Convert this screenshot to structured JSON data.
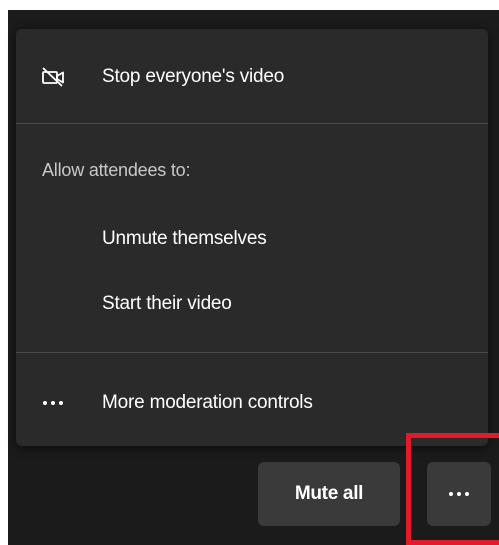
{
  "menu": {
    "stop_video": {
      "label": "Stop everyone's video",
      "icon": "video-off-icon"
    },
    "section_title": "Allow attendees to:",
    "options": [
      {
        "label": "Unmute themselves"
      },
      {
        "label": "Start their video"
      }
    ],
    "more_controls": {
      "label": "More moderation controls",
      "icon": "ellipsis-icon"
    }
  },
  "toolbar": {
    "mute_all_label": "Mute all",
    "more_button_icon": "ellipsis-icon"
  },
  "colors": {
    "highlight": "#e3192c",
    "menu_bg": "#2a2a2a",
    "button_bg": "#3a3a3a"
  }
}
